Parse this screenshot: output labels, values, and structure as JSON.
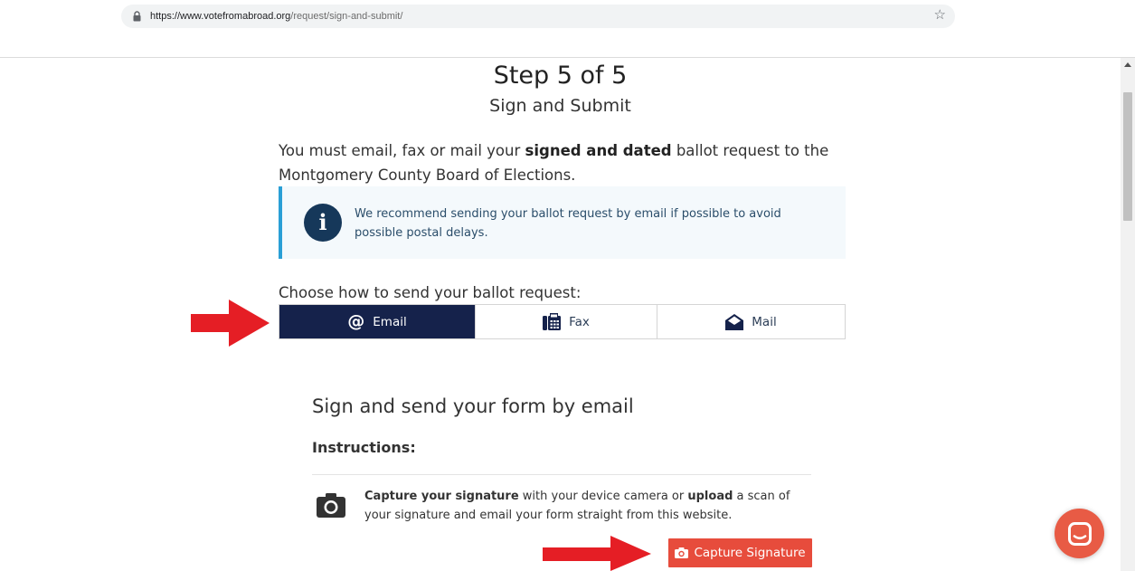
{
  "browser": {
    "url_host": "https://www.votefromabroad.org",
    "url_path": "/request/sign-and-submit/",
    "lock_icon": "lock-icon",
    "bookmark_icon": "star-icon"
  },
  "header": {
    "step": "Step 5 of 5",
    "subtitle": "Sign and Submit"
  },
  "intro": {
    "part1": "You must email, fax or mail your ",
    "bold": "signed and dated",
    "part2": " ballot request to the Montgomery County Board of Elections."
  },
  "alert": {
    "icon": "info-icon",
    "glyph": "i",
    "text": "We recommend sending your ballot request by email if possible to avoid possible postal delays."
  },
  "send_method": {
    "label": "Choose how to send your ballot request:",
    "tabs": [
      {
        "label": "Email",
        "icon": "at-icon",
        "selected": true
      },
      {
        "label": "Fax",
        "icon": "fax-icon",
        "selected": false
      },
      {
        "label": "Mail",
        "icon": "envelope-open-icon",
        "selected": false
      }
    ]
  },
  "email_section": {
    "title": "Sign and send your form by email",
    "instructions_label": "Instructions:",
    "capture_bold1": "Capture your signature",
    "capture_mid": " with your device camera or ",
    "capture_bold2": "upload",
    "capture_end": " a scan of your signature and email your form straight from this website.",
    "capture_button": "Capture Signature"
  },
  "colors": {
    "accent_navy": "#15224b",
    "info_blue": "#2a9fd6",
    "button_red": "#e74c3c",
    "arrow_red": "#e51e25",
    "chat_orange": "#e85b45"
  }
}
